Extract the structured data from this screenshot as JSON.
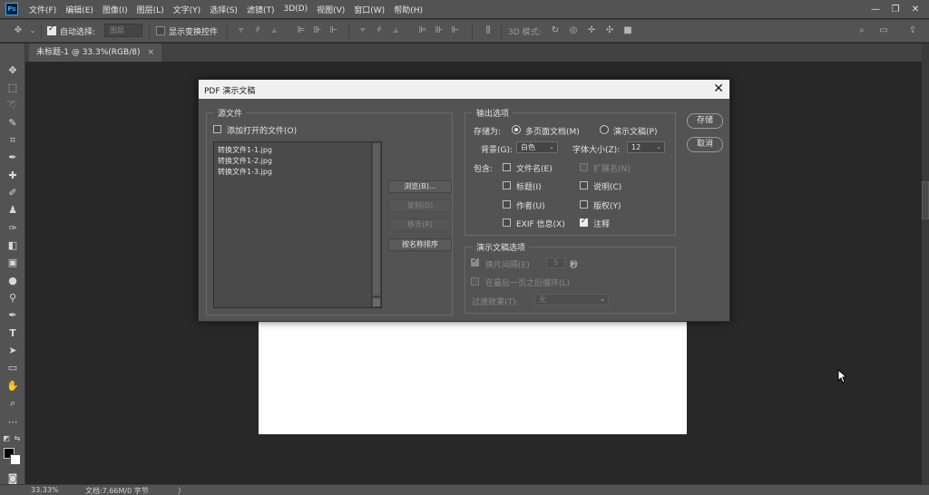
{
  "menubar": {
    "logo": "Ps",
    "items": [
      "文件(F)",
      "编辑(E)",
      "图像(I)",
      "图层(L)",
      "文字(Y)",
      "选择(S)",
      "滤镜(T)",
      "3D(D)",
      "视图(V)",
      "窗口(W)",
      "帮助(H)"
    ],
    "window_controls": [
      "—",
      "❐",
      "✕"
    ]
  },
  "optbar": {
    "auto_select_label": "自动选择:",
    "auto_select_target": "图层",
    "show_transform_label": "显示变换控件",
    "mode_3d_label": "3D 模式:"
  },
  "doc_tab": {
    "title": "未标题-1 @ 33.3%(RGB/8)",
    "close": "×"
  },
  "status": {
    "zoom": "33.33%",
    "doc_info": "文档:7.66M/0 字节",
    "arrow": "〉"
  },
  "dialog": {
    "title": "PDF 演示文稿",
    "close": "✕",
    "source": {
      "group_label": "源文件",
      "add_open_files_label": "添加打开的文件(O)",
      "files": [
        "转换文件1-1.jpg",
        "转换文件1-2.jpg",
        "转换文件1-3.jpg"
      ],
      "browse_button": "浏览(B)...",
      "duplicate_button": "复制(D)",
      "remove_button": "移去(R)",
      "sort_button": "按名称排序"
    },
    "output": {
      "group_label": "输出选项",
      "save_as_label": "存储为:",
      "multipage_label": "多页面文档(M)",
      "presentation_label": "演示文稿(P)",
      "background_label": "背景(G):",
      "background_value": "白色",
      "font_size_label": "字体大小(Z):",
      "font_size_value": "12",
      "include_label": "包含:",
      "filename_label": "文件名(E)",
      "extension_label": "扩展名(N)",
      "title_label": "标题(I)",
      "description_label": "说明(C)",
      "author_label": "作者(U)",
      "copyright_label": "版权(Y)",
      "exif_label": "EXIF 信息(X)",
      "notes_label": "注释"
    },
    "presentation_options": {
      "group_label": "演示文稿选项",
      "advance_label": "换片间隔(E)",
      "advance_value": "5",
      "seconds_label": "秒",
      "loop_label": "在最后一页之后循环(L)",
      "transition_label": "过渡效果(T):",
      "transition_value": "无"
    },
    "save_button": "存储",
    "cancel_button": "取消"
  },
  "colors": {
    "chrome": "#535353",
    "canvas_bg": "#282828",
    "dialog_titlebar": "#f0f0f0"
  }
}
